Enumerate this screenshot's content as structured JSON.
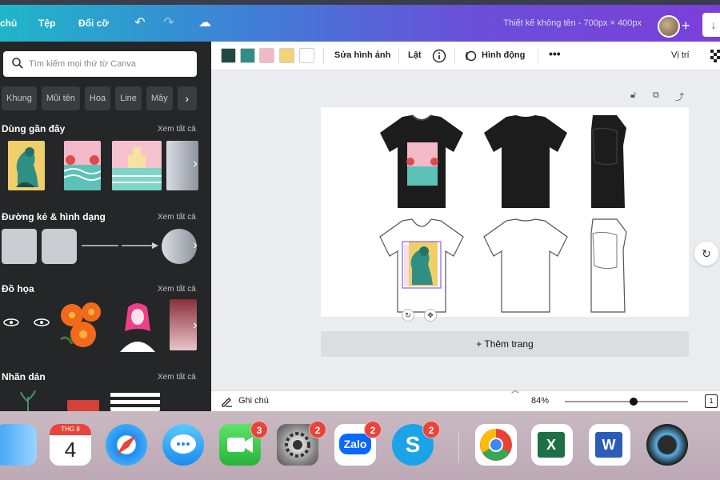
{
  "topbar": {
    "menu": [
      "chủ",
      "Tệp",
      "Đổi cỡ"
    ],
    "doc_title": "Thiết kế không tên - 700px × 400px"
  },
  "left_panel": {
    "search_placeholder": "Tìm kiếm mọi thứ từ Canva",
    "chips": [
      "Khung",
      "Mũi tên",
      "Hoa",
      "Line",
      "Mây"
    ],
    "sections": [
      {
        "title": "Dùng gần đây",
        "see_all": "Xem tất cả"
      },
      {
        "title": "Đường kẻ & hình dạng",
        "see_all": "Xem tất cả"
      },
      {
        "title": "Đồ họa",
        "see_all": "Xem tất cả"
      },
      {
        "title": "Nhãn dán",
        "see_all": "Xem tất cả"
      }
    ]
  },
  "context_bar": {
    "swatches": [
      "#1e4a44",
      "#2f8f84",
      "#f2b8c6",
      "#f2d27a",
      "#ffffff"
    ],
    "edit_image": "Sửa hình ảnh",
    "flip": "Lật",
    "animate": "Hình động",
    "position": "Vị trí"
  },
  "canvas": {
    "add_page": "+ Thêm trang"
  },
  "bottom_bar": {
    "notes": "Ghi chú",
    "zoom": "84%",
    "zoom_fraction": 0.56,
    "page_number": "1"
  },
  "dock": {
    "calendar_month": "THG 8",
    "calendar_day": "4",
    "facetime_badge": "3",
    "settings_badge": "2",
    "zalo_label": "Zalo",
    "zalo_badge": "2",
    "skype_badge": "2",
    "excel_letter": "X",
    "word_letter": "W"
  }
}
